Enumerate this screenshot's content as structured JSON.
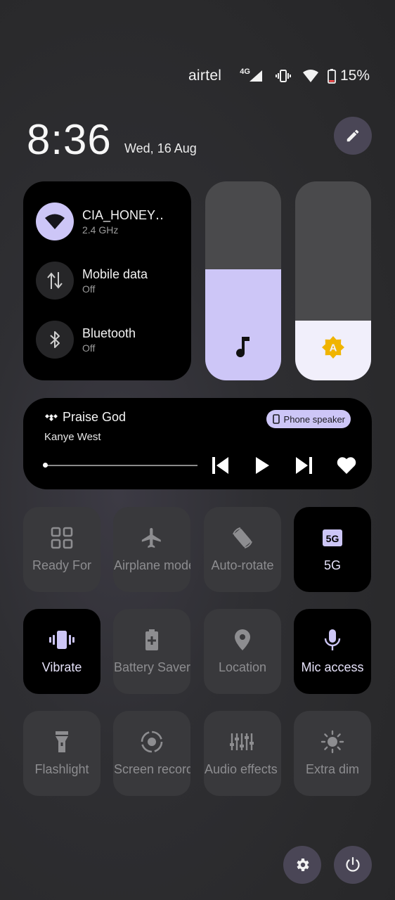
{
  "status_bar": {
    "carrier": "airtel",
    "network_type": "4G",
    "battery_percent": "15%",
    "icons": [
      "signal-icon",
      "vibrate-icon",
      "wifi-icon",
      "battery-icon"
    ]
  },
  "header": {
    "time": "8:36",
    "date": "Wed, 16 Aug",
    "edit_icon": "pencil-icon"
  },
  "network": {
    "wifi": {
      "title": "CIA_HONEY‥",
      "subtitle": "2.4 GHz",
      "active": true
    },
    "mobile_data": {
      "title": "Mobile data",
      "subtitle": "Off",
      "active": false
    },
    "bluetooth": {
      "title": "Bluetooth",
      "subtitle": "Off",
      "active": false
    }
  },
  "sliders": {
    "media_volume": {
      "icon": "music-note-icon",
      "level": 0.56,
      "fill_color": "#cdc6f7"
    },
    "brightness": {
      "icon": "auto-brightness-icon",
      "level": 0.3,
      "fill_color": "#f1effb"
    }
  },
  "media": {
    "title": "Praise God",
    "artist": "Kanye West",
    "output_chip": "Phone speaker",
    "progress": 0.0,
    "controls": [
      "previous-icon",
      "play-icon",
      "next-icon",
      "heart-icon"
    ]
  },
  "tiles": [
    {
      "label": "Ready For",
      "icon": "grid-icon",
      "on": false
    },
    {
      "label": "Airplane mode",
      "icon": "airplane-icon",
      "on": false
    },
    {
      "label": "Auto-rotate",
      "icon": "rotate-icon",
      "on": false
    },
    {
      "label": "5G",
      "icon": "5g-icon",
      "on": true
    },
    {
      "label": "Vibrate",
      "icon": "vibrate-icon",
      "on": true
    },
    {
      "label": "Battery Saver",
      "icon": "battery-saver-icon",
      "on": false
    },
    {
      "label": "Location",
      "icon": "location-icon",
      "on": false
    },
    {
      "label": "Mic access",
      "icon": "mic-icon",
      "on": true
    },
    {
      "label": "Flashlight",
      "icon": "flashlight-icon",
      "on": false
    },
    {
      "label": "Screen record",
      "icon": "screen-record-icon",
      "on": false
    },
    {
      "label": "Audio effects",
      "icon": "equalizer-icon",
      "on": false
    },
    {
      "label": "Extra dim",
      "icon": "extra-dim-icon",
      "on": false
    }
  ],
  "footer": {
    "settings_icon": "gear-icon",
    "power_icon": "power-icon"
  },
  "colors": {
    "accent": "#cdc6f7",
    "tile_off": "#39393c",
    "tile_on": "#000000",
    "round_button": "#4a4656"
  }
}
